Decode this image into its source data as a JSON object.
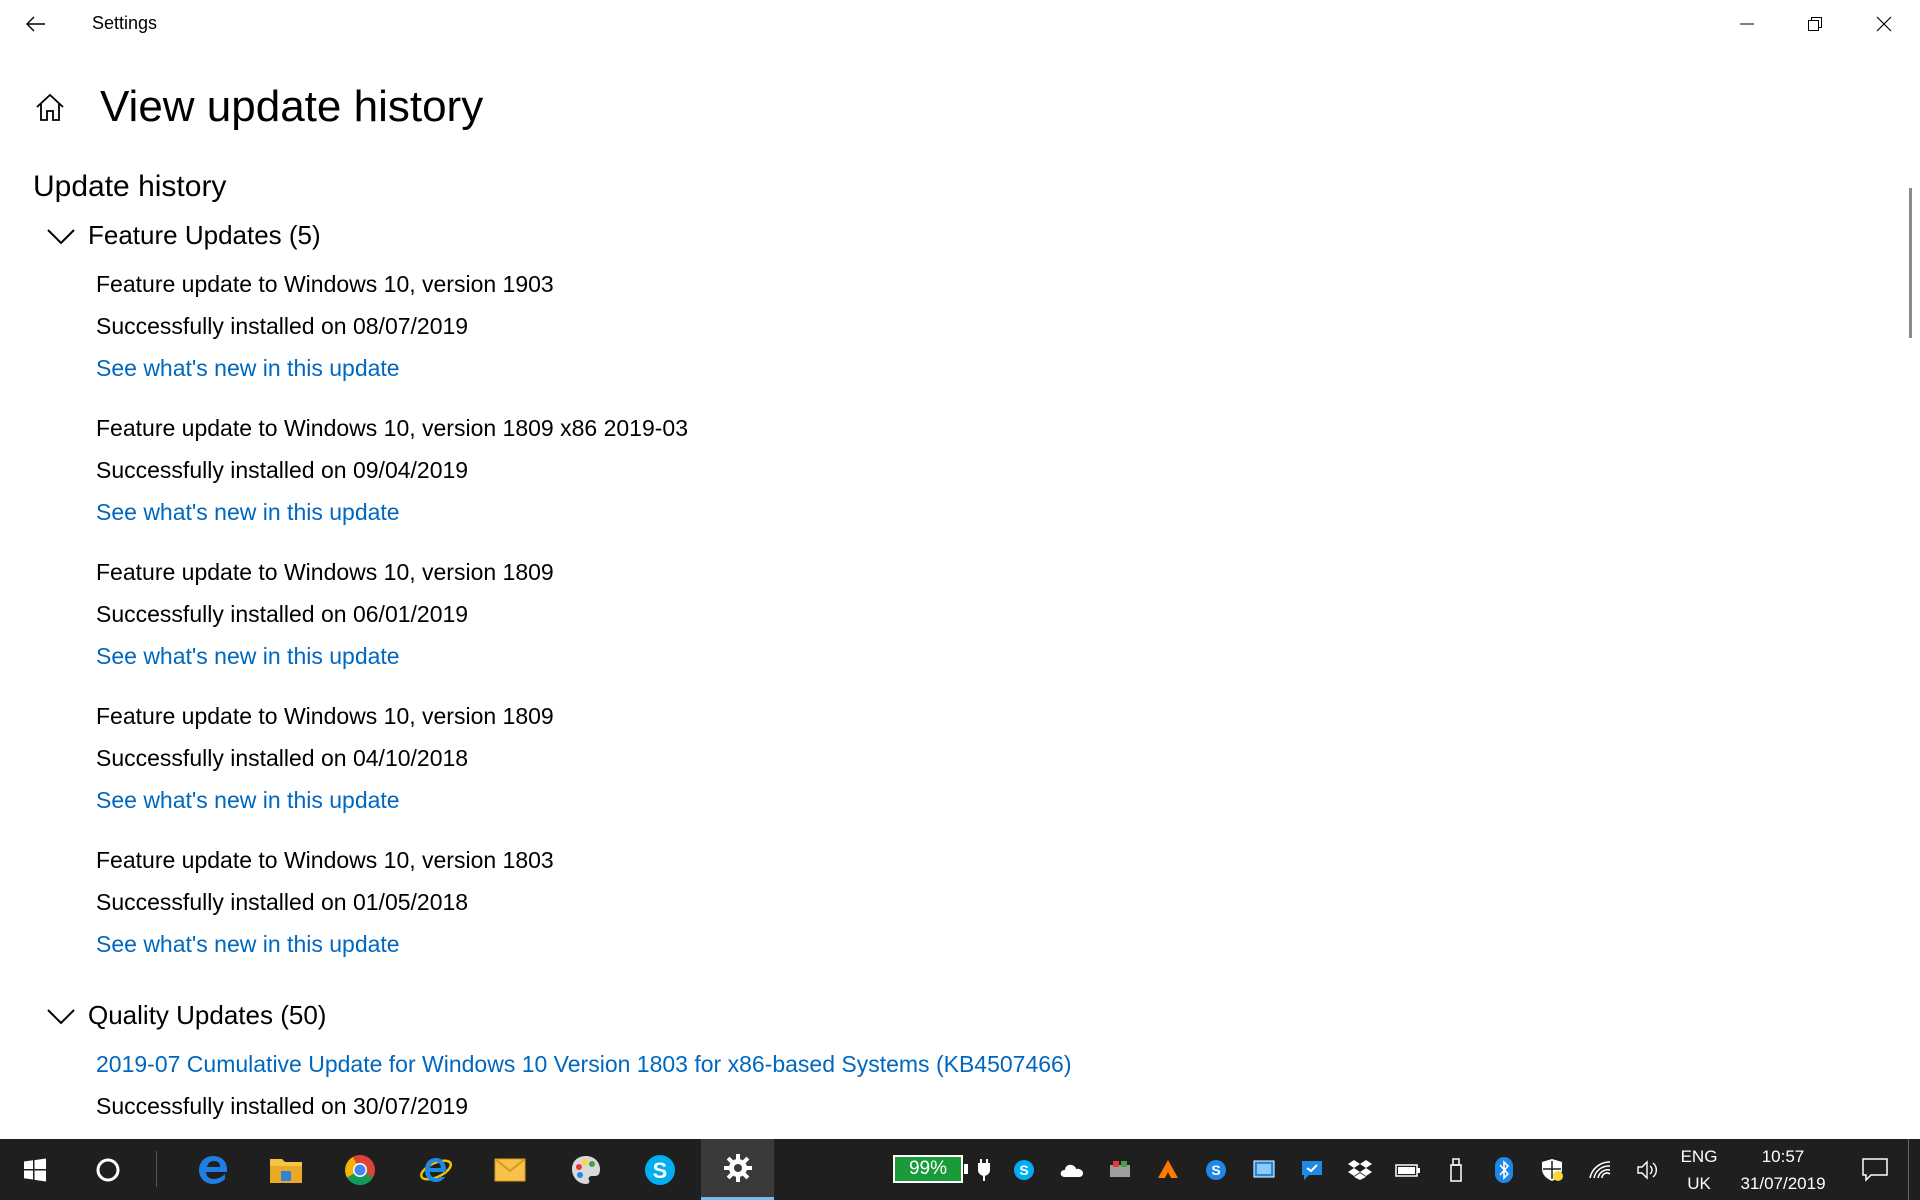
{
  "window": {
    "title": "Settings"
  },
  "page": {
    "title": "View update history",
    "section": "Update history"
  },
  "groups": {
    "feature": {
      "label": "Feature Updates (5)",
      "items": [
        {
          "title": "Feature update to Windows 10, version 1903",
          "status": "Successfully installed on 08/07/2019",
          "link": "See what's new in this update"
        },
        {
          "title": "Feature update to Windows 10, version 1809 x86 2019-03",
          "status": "Successfully installed on 09/04/2019",
          "link": "See what's new in this update"
        },
        {
          "title": "Feature update to Windows 10, version 1809",
          "status": "Successfully installed on 06/01/2019",
          "link": "See what's new in this update"
        },
        {
          "title": "Feature update to Windows 10, version 1809",
          "status": "Successfully installed on 04/10/2018",
          "link": "See what's new in this update"
        },
        {
          "title": "Feature update to Windows 10, version 1803",
          "status": "Successfully installed on 01/05/2018",
          "link": "See what's new in this update"
        }
      ]
    },
    "quality": {
      "label": "Quality Updates (50)",
      "items": [
        {
          "title": "2019-07 Cumulative Update for Windows 10 Version 1803 for x86-based Systems (KB4507466)",
          "status": "Successfully installed on 30/07/2019"
        }
      ]
    }
  },
  "taskbar": {
    "battery": "99%",
    "language": "ENG",
    "region": "UK",
    "time": "10:57",
    "date": "31/07/2019",
    "apps": [
      "start-icon",
      "cortana-icon",
      "edge-icon",
      "file-explorer-icon",
      "chrome-icon",
      "internet-explorer-icon",
      "mail-app-icon",
      "paint-icon",
      "skype-icon",
      "settings-gear-icon"
    ]
  },
  "colors": {
    "link": "#0067c0",
    "taskbar": "#1f1f1f",
    "battery": "#1a9b3a"
  }
}
